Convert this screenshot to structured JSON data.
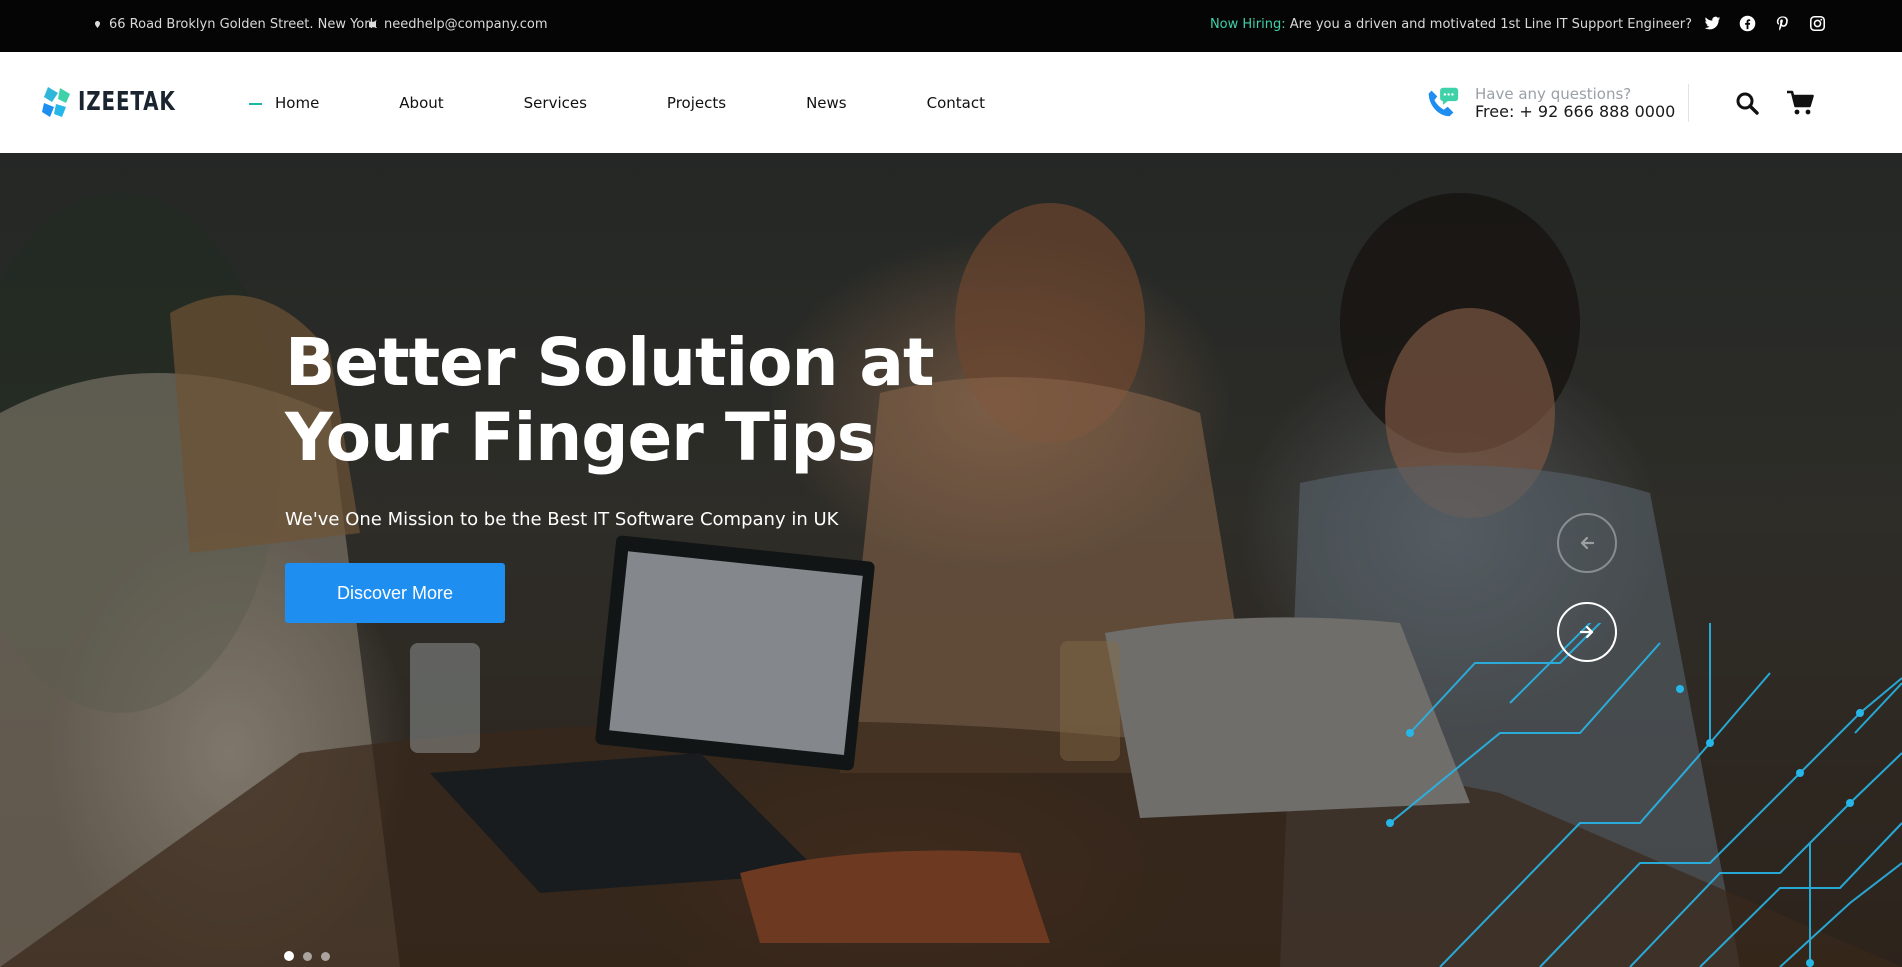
{
  "topbar": {
    "address": "66 Road Broklyn Golden Street. New York",
    "email": "needhelp@company.com",
    "hiring_label": "Now Hiring:",
    "hiring_text": " Are you a driven and motivated 1st Line IT Support Engineer?",
    "socials": [
      "twitter-icon",
      "facebook-icon",
      "pinterest-icon",
      "instagram-icon"
    ]
  },
  "header": {
    "logo_text": "IZEETAK",
    "nav": [
      "Home",
      "About",
      "Services",
      "Projects",
      "News",
      "Contact"
    ],
    "active_nav": "Home",
    "phone_question": "Have any questions?",
    "phone_number": "Free: + 92 666 888 0000"
  },
  "hero": {
    "title_line1": "Better Solution at",
    "title_line2": "Your Finger Tips",
    "subtitle": "We've One Mission to be the Best IT Software Company in UK",
    "button_label": "Discover More",
    "slides": 3,
    "active_slide": 1
  },
  "colors": {
    "accent_green": "#3fd1a8",
    "button_blue": "#1f8ef1",
    "topbar_bg": "#050505",
    "circuit": "#27b6e8"
  }
}
